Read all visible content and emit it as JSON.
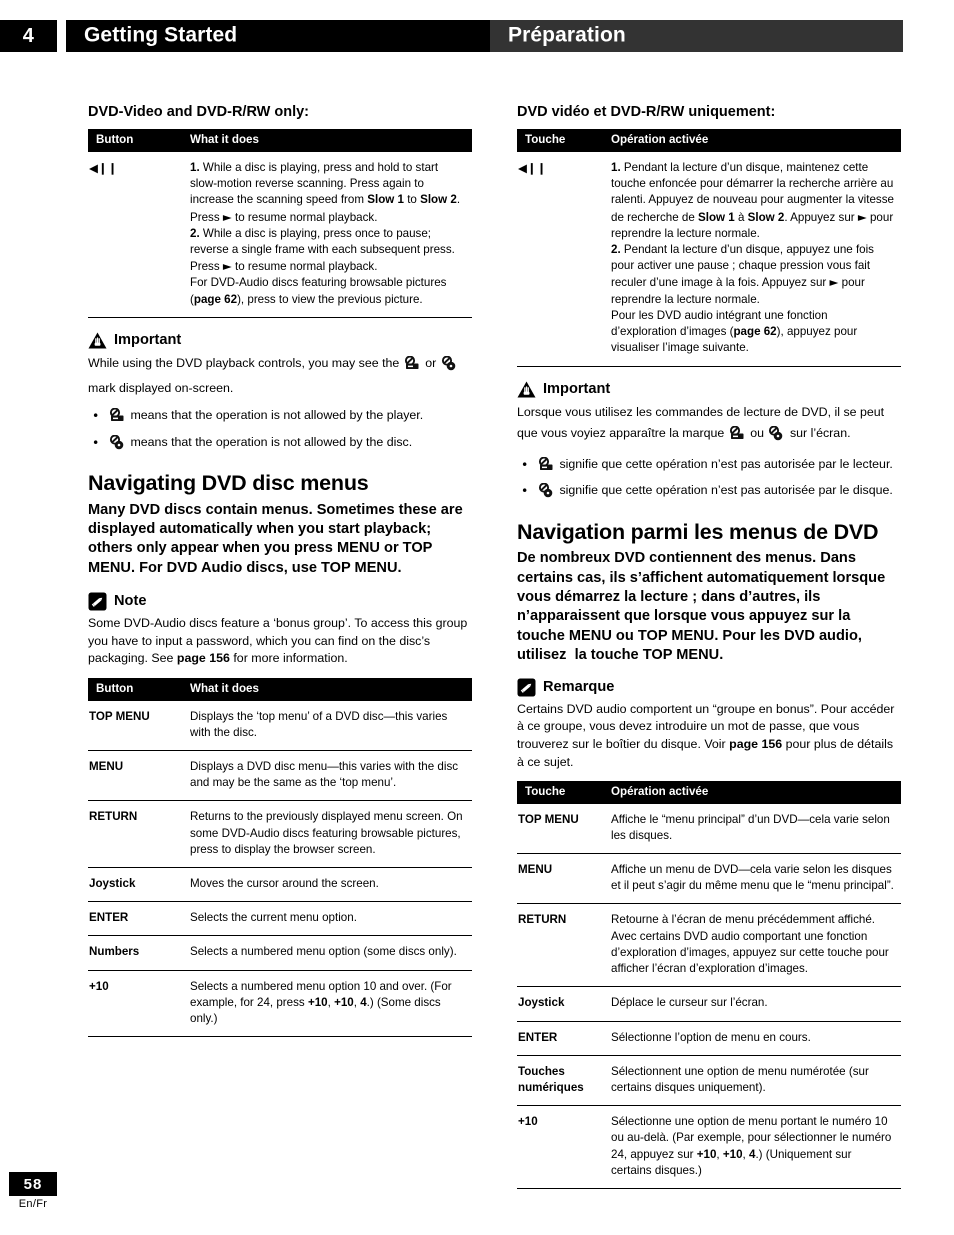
{
  "header": {
    "chapter_number": "4",
    "title_en": "Getting Started",
    "title_fr": "Préparation",
    "band_en_color": "#000000",
    "band_fr_color": "#333333"
  },
  "footer": {
    "page_number": "58",
    "languages": "En/Fr"
  },
  "left_column": {
    "subheading": "DVD-Video and DVD-R/RW only:",
    "table1": {
      "headers": [
        "Button",
        "What it does"
      ],
      "rows": [
        {
          "button": "◀❙❙",
          "paragraphs": [
            "1. While a disc is playing, press and hold to start slow-motion reverse scanning. Press again to increase the scanning speed from Slow 1 to Slow 2. Press ► to resume normal playback.",
            "2. While a disc is playing, press once to pause; reverse a single frame with each subsequent press. Press ► to resume normal playback.",
            "For DVD-Audio discs featuring browsable pictures (page 62), press to view the previous picture."
          ]
        }
      ]
    },
    "important": {
      "icon": "warning-triangle-icon",
      "title": "Important",
      "body_before": "While using the DVD playback controls, you may see the",
      "body_middle": "or",
      "body_after": "mark displayed on-screen.",
      "bullets": [
        {
          "icon": "player-prohibited-icon",
          "text": "means that the operation is not allowed by the player."
        },
        {
          "icon": "disc-prohibited-icon",
          "text": "means that the operation is not allowed by the disc."
        }
      ]
    },
    "section_heading": "Navigating DVD disc menus",
    "section_intro": "Many DVD discs contain menus. Sometimes these are displayed automatically when you start playback; others only appear when you press MENU or TOP MENU. For DVD Audio discs, use TOP MENU.",
    "note": {
      "icon": "pencil-note-icon",
      "title": "Note",
      "body": "Some DVD-Audio discs feature a ‘bonus group’. To access this group you have to input a password, which you can find on the disc’s packaging. See page 156 for more information."
    },
    "table2": {
      "headers": [
        "Button",
        "What it does"
      ],
      "rows": [
        {
          "button": "TOP MENU",
          "description": "Displays the ‘top menu’ of a DVD disc—this varies with the disc."
        },
        {
          "button": "MENU",
          "description": "Displays a DVD disc menu—this varies with the disc and may be the same as the ‘top menu’."
        },
        {
          "button": "RETURN",
          "description": "Returns to the previously displayed menu screen. On some DVD-Audio discs featuring browsable pictures, press to display the browser screen."
        },
        {
          "button": "Joystick",
          "description": "Moves the cursor around the screen."
        },
        {
          "button": "ENTER",
          "description": "Selects the current menu option."
        },
        {
          "button": "Numbers",
          "description": "Selects a numbered menu option (some discs only)."
        },
        {
          "button": "+10",
          "description": "Selects a numbered menu option 10 and over. (For example, for 24, press +10, +10, 4.) (Some discs only.)"
        }
      ]
    }
  },
  "right_column": {
    "subheading": "DVD vidéo et DVD-R/RW uniquement:",
    "table1": {
      "headers": [
        "Touche",
        "Opération activée"
      ],
      "rows": [
        {
          "button": "◀❙❙",
          "paragraphs": [
            "1. Pendant la lecture d’un disque, maintenez cette touche enfoncée pour démarrer la recherche arrière au ralenti. Appuyez de nouveau pour augmenter la vitesse de recherche de Slow 1 à Slow 2. Appuyez sur ► pour reprendre la lecture normale.",
            "2. Pendant la lecture d’un disque, appuyez une fois pour activer une pause ; chaque pression vous fait reculer d’une image à la fois. Appuyez sur ► pour reprendre la lecture normale.",
            "Pour les DVD audio intégrant une fonction d’exploration d’images (page 62), appuyez pour visualiser l’image suivante."
          ]
        }
      ]
    },
    "important": {
      "icon": "warning-triangle-icon",
      "title": "Important",
      "body_before": "Lorsque vous utilisez les commandes de lecture de DVD, il se peut que vous voyiez apparaître la marque",
      "body_middle": "ou",
      "body_after": "sur l’écran.",
      "bullets": [
        {
          "icon": "player-prohibited-icon",
          "text": "signifie que cette opération n’est pas autorisée par le lecteur."
        },
        {
          "icon": "disc-prohibited-icon",
          "text": "signifie que cette opération n’est pas autorisée par le disque."
        }
      ]
    },
    "section_heading": "Navigation parmi les menus de DVD",
    "section_intro": "De nombreux DVD contiennent des menus. Dans certains cas, ils s’affichent automatiquement lorsque vous démarrez la lecture ; dans d’autres, ils n’apparaissent que lorsque vous appuyez sur la touche MENU ou TOP MENU. Pour les DVD audio, utilisez  la touche TOP MENU.",
    "note": {
      "icon": "pencil-note-icon",
      "title": "Remarque",
      "body": "Certains DVD audio comportent un “groupe en bonus”. Pour accéder à ce groupe, vous devez introduire un mot de passe, que vous trouverez sur le boîtier du disque. Voir page 156 pour plus de détails à ce sujet."
    },
    "table2": {
      "headers": [
        "Touche",
        "Opération activée"
      ],
      "rows": [
        {
          "button": "TOP MENU",
          "description": "Affiche le “menu principal” d’un DVD—cela varie selon les disques."
        },
        {
          "button": "MENU",
          "description": "Affiche un menu de DVD—cela varie selon les disques et il peut s’agir du même menu que le “menu principal”."
        },
        {
          "button": "RETURN",
          "description": "Retourne à l’écran de menu précédemment affiché. Avec certains DVD audio comportant une fonction d’exploration d’images, appuyez sur cette touche pour afficher l’écran d’exploration d’images."
        },
        {
          "button": "Joystick",
          "description": "Déplace le curseur sur l’écran."
        },
        {
          "button": "ENTER",
          "description": "Sélectionne l’option de menu en cours."
        },
        {
          "button": "Touches numériques",
          "description": "Sélectionnent une option de menu numérotée (sur certains disques uniquement)."
        },
        {
          "button": "+10",
          "description": "Sélectionne une option de menu portant le numéro 10 ou au-delà. (Par exemple, pour sélectionner le numéro 24, appuyez sur +10, +10, 4.) (Uniquement sur certains disques.)"
        }
      ]
    }
  }
}
